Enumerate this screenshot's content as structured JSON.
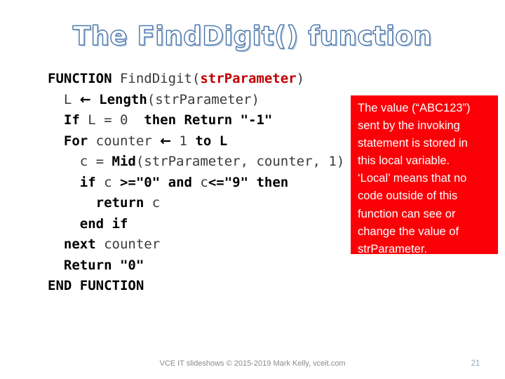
{
  "slide": {
    "title": "The FindDigit() function",
    "background_color": "#ffffff",
    "title_outline_color": "#4472a8",
    "accent_color": "#fb0007"
  },
  "code": {
    "language": "pseudocode",
    "lines": [
      {
        "indent": 0,
        "segments": [
          {
            "text": "FUNCTION ",
            "style": "keyword"
          },
          {
            "text": "FindDigit(",
            "style": "plain"
          },
          {
            "text": "strParameter",
            "style": "parameter"
          },
          {
            "text": ")",
            "style": "plain"
          }
        ]
      },
      {
        "indent": 1,
        "segments": [
          {
            "text": "L ",
            "style": "plain"
          },
          {
            "text": "←",
            "style": "keyword"
          },
          {
            "text": " Length",
            "style": "keyword"
          },
          {
            "text": "(strParameter)",
            "style": "plain"
          }
        ]
      },
      {
        "indent": 1,
        "segments": [
          {
            "text": "If ",
            "style": "keyword"
          },
          {
            "text": "L = 0",
            "style": "plain"
          },
          {
            "text": "  then Return \"-1\"",
            "style": "keyword"
          }
        ]
      },
      {
        "indent": 1,
        "segments": [
          {
            "text": "For ",
            "style": "keyword"
          },
          {
            "text": "counter ",
            "style": "plain"
          },
          {
            "text": "←",
            "style": "keyword"
          },
          {
            "text": " 1 ",
            "style": "plain"
          },
          {
            "text": "to L",
            "style": "keyword"
          }
        ]
      },
      {
        "indent": 2,
        "segments": [
          {
            "text": "c = ",
            "style": "plain"
          },
          {
            "text": "Mid",
            "style": "keyword"
          },
          {
            "text": "(strParameter, counter, 1)",
            "style": "plain"
          }
        ]
      },
      {
        "indent": 2,
        "segments": [
          {
            "text": "if ",
            "style": "keyword"
          },
          {
            "text": "c ",
            "style": "plain"
          },
          {
            "text": ">=\"0\" ",
            "style": "keyword"
          },
          {
            "text": "and ",
            "style": "keyword"
          },
          {
            "text": "c",
            "style": "plain"
          },
          {
            "text": "<=\"9\" ",
            "style": "keyword"
          },
          {
            "text": "then",
            "style": "keyword"
          }
        ]
      },
      {
        "indent": 3,
        "segments": [
          {
            "text": "return ",
            "style": "keyword"
          },
          {
            "text": "c",
            "style": "plain"
          }
        ]
      },
      {
        "indent": 2,
        "segments": [
          {
            "text": "end if",
            "style": "keyword"
          }
        ]
      },
      {
        "indent": 1,
        "segments": [
          {
            "text": "next ",
            "style": "keyword"
          },
          {
            "text": "counter",
            "style": "plain"
          }
        ]
      },
      {
        "indent": 1,
        "segments": [
          {
            "text": "Return \"0\"",
            "style": "keyword"
          }
        ]
      },
      {
        "indent": 0,
        "segments": [
          {
            "text": "END FUNCTION",
            "style": "keyword"
          }
        ]
      }
    ]
  },
  "callout": {
    "background_color": "#fb0007",
    "text_color": "#ffffff",
    "full_text": "The value (“ABC123”) sent by the invoking statement is stored in this local variable. ‘Local’ means that no code outside of this function can see or change the value of strParameter.",
    "lines": [
      "The value (“ABC123”)",
      "sent by the invoking",
      "statement is stored in",
      "this local variable.",
      "‘Local’ means that no",
      "code outside of this",
      "function can see or",
      "change the value of",
      "strParameter."
    ]
  },
  "footer": {
    "credit": "VCE IT slideshows © 2015-2019 Mark Kelly, vceit.com",
    "page_number": "21"
  }
}
